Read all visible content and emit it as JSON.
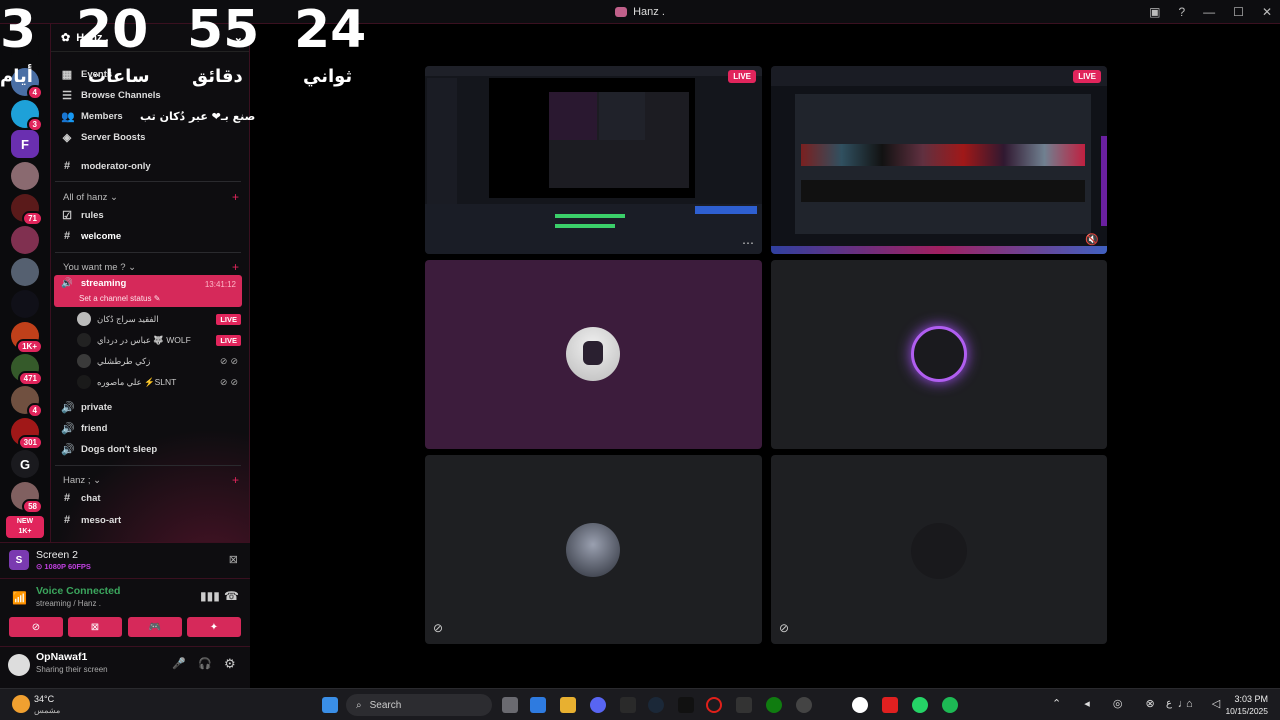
{
  "window": {
    "title": "Hanz ."
  },
  "overlay": {
    "values": [
      "3",
      "20",
      "55",
      "24"
    ],
    "labels": [
      "أيام",
      "ساعات",
      "دقائق",
      "ثواني"
    ],
    "caption": "صنع بـ❤ عبر دُكان تب"
  },
  "server_header": {
    "name": "Hanz ."
  },
  "menu": {
    "events": "Events",
    "browse": "Browse Channels",
    "members": "Members",
    "boosts": "Server Boosts",
    "moderator": "moderator-only"
  },
  "categories": {
    "all_of_hanz": "All of hanz",
    "you_want_me": "You want me ?",
    "hanz": "Hanz ;"
  },
  "channels": {
    "rules": "rules",
    "welcome": "welcome",
    "streaming": "streaming",
    "streaming_time": "13:41:12",
    "streaming_status": "Set a channel status",
    "private": "private",
    "friend": "friend",
    "dogs": "Dogs don't sleep",
    "chat": "chat",
    "meso": "meso-art"
  },
  "voice_users": [
    {
      "name": "الفقيد سراج دُكان",
      "tag": "LIVE"
    },
    {
      "name": "عباس در درداي 🐺 WOLF",
      "tag": "LIVE"
    },
    {
      "name": "زكي طرطشلي",
      "tag": ""
    },
    {
      "name": "علي ماصوره ⚡SLNT",
      "tag": ""
    }
  ],
  "server_badges": [
    "4",
    "3",
    "71",
    "1K+",
    "471",
    "4",
    "301",
    "58",
    "1K+"
  ],
  "server_new": "NEW",
  "server_letters": {
    "f": "F",
    "g": "G"
  },
  "screen": {
    "title": "Screen 2",
    "sub": "1080P 60FPS"
  },
  "voice": {
    "status": "Voice Connected",
    "channel": "streaming / Hanz ."
  },
  "user": {
    "name": "OpNawaf1",
    "status": "Sharing their screen"
  },
  "tiles": {
    "live": "LIVE"
  },
  "taskbar": {
    "weather_temp": "34°C",
    "weather_desc": "مشمس",
    "search": "Search",
    "time": "3:03 PM",
    "date": "10/15/2025",
    "lang": "ع"
  },
  "colors": {
    "accent": "#d6295a",
    "voice_green": "#3ba55d"
  }
}
